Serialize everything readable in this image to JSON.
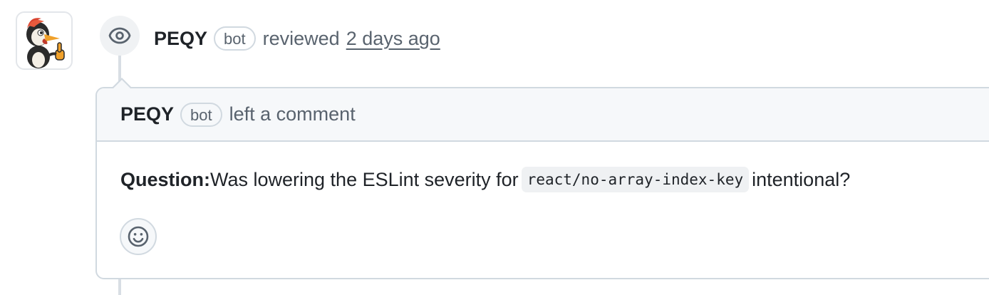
{
  "review_event": {
    "author": "PEQY",
    "author_badge": "bot",
    "action": "reviewed",
    "timestamp": "2 days ago"
  },
  "comment": {
    "header": {
      "author": "PEQY",
      "author_badge": "bot",
      "action": "left a comment"
    },
    "body": {
      "label": "Question:",
      "text_before": "Was lowering the ESLint severity for",
      "code": "react/no-array-index-key",
      "text_after": "intentional?"
    }
  },
  "icons": {
    "avatar": "woodpecker-thumbs-up-avatar",
    "review": "eye-icon",
    "reaction": "smiley-icon"
  },
  "colors": {
    "text_primary": "#1f2328",
    "text_muted": "#59636e",
    "border": "#d1d9e0",
    "header_bg": "#f6f8fa",
    "code_bg": "#eff1f3"
  }
}
